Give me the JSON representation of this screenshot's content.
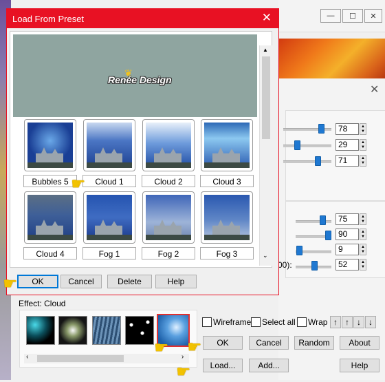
{
  "window_controls": {
    "minimize": "—",
    "maximize": "☐",
    "close": "✕"
  },
  "bg_dialog_close": "✕",
  "sliders_top": [
    {
      "value": "78",
      "level": 0.78
    },
    {
      "value": "29",
      "level": 0.29
    },
    {
      "value": "71",
      "level": 0.71
    }
  ],
  "sliders_bottom": [
    {
      "value": "75",
      "level": 0.75
    },
    {
      "value": "90",
      "level": 0.9
    },
    {
      "value": "9",
      "level": 0.09
    },
    {
      "value": "52",
      "level": 0.52
    }
  ],
  "bottom_slider_prefix": "00):",
  "dialog": {
    "title": "Load From Preset",
    "close": "✕",
    "banner_text": "Renée Design",
    "presets": [
      "Bubbles 5",
      "Cloud 1",
      "Cloud 2",
      "Cloud 3",
      "Cloud 4",
      "Fog 1",
      "Fog 2",
      "Fog 3"
    ],
    "buttons": {
      "ok": "OK",
      "cancel": "Cancel",
      "delete": "Delete",
      "help": "Help"
    }
  },
  "effect": {
    "label": "Effect: Cloud"
  },
  "options": {
    "wireframe": "Wireframe",
    "select_all": "Select all",
    "wrap": "Wrap"
  },
  "main_buttons": {
    "ok": "OK",
    "cancel": "Cancel",
    "random": "Random",
    "about": "About",
    "load": "Load...",
    "add": "Add...",
    "help": "Help"
  },
  "arrows": [
    "↑",
    "↑",
    "↓",
    "↓"
  ],
  "colors": {
    "accent": "#e81123",
    "focus": "#0078d7",
    "highlight": "#e03030"
  }
}
